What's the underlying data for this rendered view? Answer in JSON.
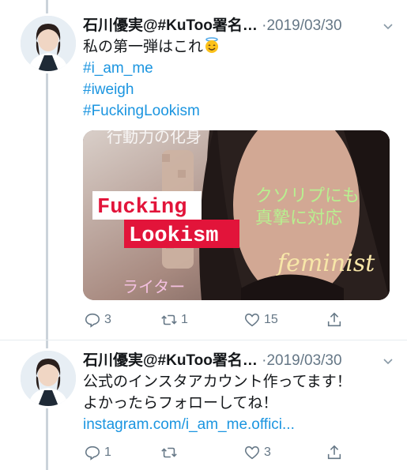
{
  "tweets": [
    {
      "author": "石川優実@#KuToo署名…",
      "dot": "·",
      "date": "2019/03/30",
      "text_lines": [
        "私の第一弾はこれ"
      ],
      "hashtags": [
        "#i_am_me",
        "#iweigh",
        "#FuckingLookism"
      ],
      "media": {
        "caption_top": "行動力の化身",
        "label_main_line1": "Fucking",
        "label_main_line2": "Lookism",
        "label_right_line1": "クソリプにも",
        "label_right_line2": "真摯に対応",
        "label_script": "feminist",
        "label_bottom": "ライター"
      },
      "actions": {
        "replies": "3",
        "retweets": "1",
        "likes": "15"
      }
    },
    {
      "author": "石川優実@#KuToo署名…",
      "dot": "·",
      "date": "2019/03/30",
      "text_lines": [
        "公式のインスタアカウント作ってます！",
        "よかったらフォローしてね！"
      ],
      "link": "instagram.com/i_am_me.offici...",
      "actions": {
        "replies": "1",
        "retweets": "",
        "likes": "3"
      }
    }
  ],
  "colors": {
    "link": "#1b95e0",
    "muted": "#657786",
    "thread_line": "#cbd3da"
  },
  "icons": [
    "reply-icon",
    "retweet-icon",
    "like-icon",
    "share-icon",
    "chevron-down-icon",
    "halo-smile-emoji"
  ]
}
